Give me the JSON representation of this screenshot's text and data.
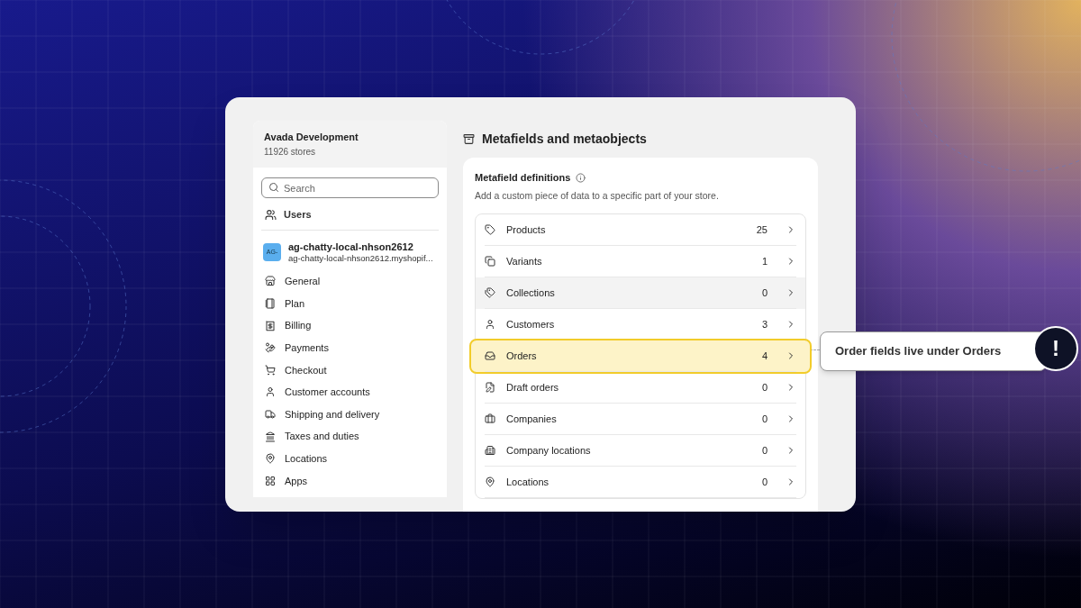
{
  "sidebar": {
    "org": {
      "name": "Avada Development",
      "subtitle": "11926 stores"
    },
    "search": {
      "placeholder": "Search"
    },
    "users": "Users",
    "store": {
      "avatar": "AG-",
      "name": "ag-chatty-local-nhson2612",
      "domain": "ag-chatty-local-nhson2612.myshopif..."
    },
    "items": [
      "General",
      "Plan",
      "Billing",
      "Payments",
      "Checkout",
      "Customer accounts",
      "Shipping and delivery",
      "Taxes and duties",
      "Locations",
      "Apps"
    ]
  },
  "main": {
    "title": "Metafields and metaobjects",
    "card": {
      "title": "Metafield definitions",
      "description": "Add a custom piece of data to a specific part of your store.",
      "rows": [
        {
          "label": "Products",
          "count": "25",
          "hovered": false,
          "highlighted": false
        },
        {
          "label": "Variants",
          "count": "1",
          "hovered": false,
          "highlighted": false
        },
        {
          "label": "Collections",
          "count": "0",
          "hovered": true,
          "highlighted": false
        },
        {
          "label": "Customers",
          "count": "3",
          "hovered": false,
          "highlighted": false
        },
        {
          "label": "Orders",
          "count": "4",
          "hovered": false,
          "highlighted": true
        },
        {
          "label": "Draft orders",
          "count": "0",
          "hovered": false,
          "highlighted": false
        },
        {
          "label": "Companies",
          "count": "0",
          "hovered": false,
          "highlighted": false
        },
        {
          "label": "Company locations",
          "count": "0",
          "hovered": false,
          "highlighted": false
        },
        {
          "label": "Locations",
          "count": "0",
          "hovered": false,
          "highlighted": false
        }
      ]
    }
  },
  "callout": {
    "text": "Order fields live under Orders",
    "mark": "!"
  }
}
